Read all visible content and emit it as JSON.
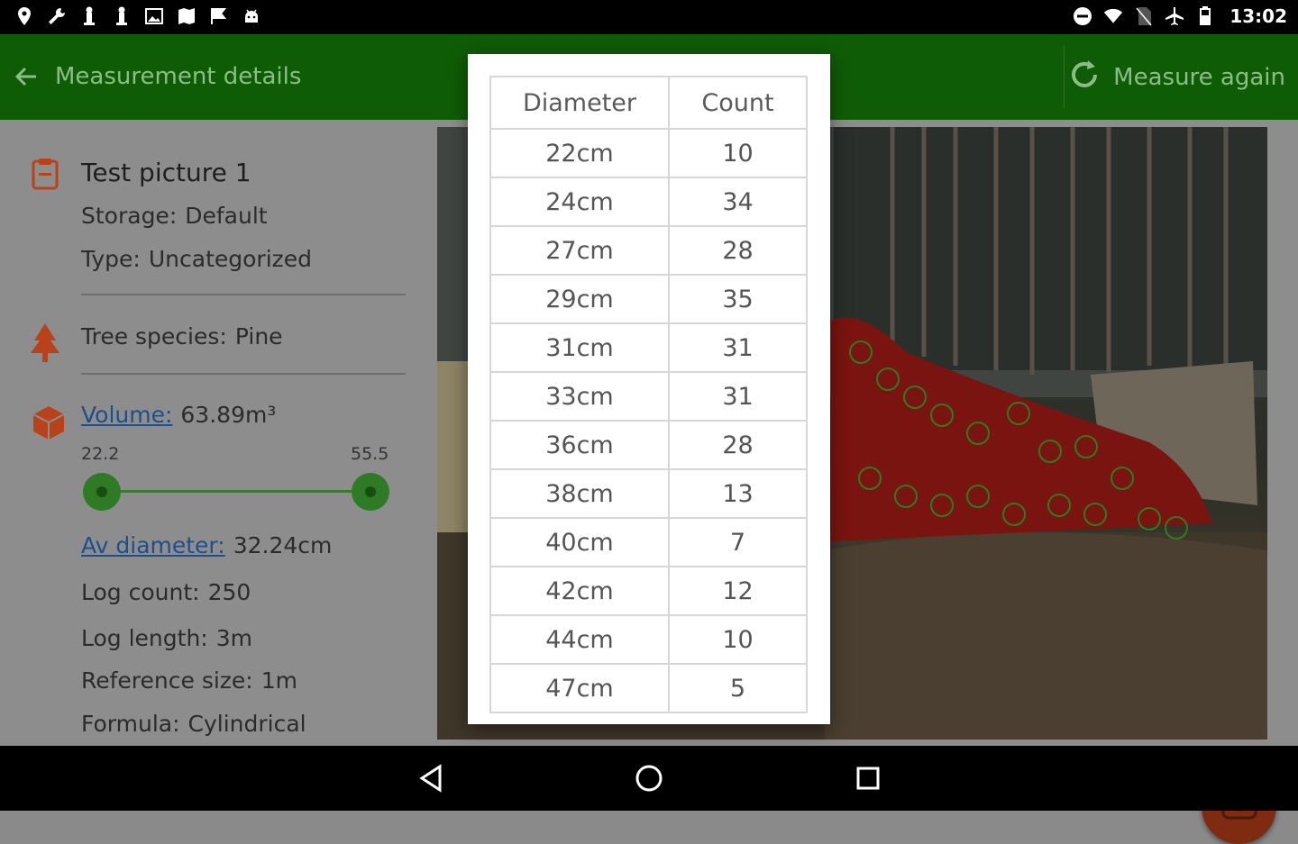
{
  "status_bar": {
    "time": "13:02",
    "left_icons": [
      "location-pin-icon",
      "wrench-icon",
      "chess-piece-icon",
      "chess-piece-icon",
      "image-icon",
      "map-icon",
      "flag-icon",
      "android-icon"
    ],
    "right_icons": [
      "do-not-disturb-icon",
      "wifi-icon",
      "no-sim-icon",
      "airplane-icon",
      "battery-icon"
    ]
  },
  "app_bar": {
    "title": "Measurement details",
    "action_label": "Measure again",
    "color": "#0f5c06"
  },
  "details": {
    "picture_title": "Test picture 1",
    "storage_label": "Storage:",
    "storage_value": "Default",
    "type_label": "Type:",
    "type_value": "Uncategorized",
    "species_label": "Tree species:",
    "species_value": "Pine",
    "volume_label": "Volume:",
    "volume_value": "63.89m³",
    "range_min": "22.2",
    "range_max": "55.5",
    "diameter_label": "Av diameter:",
    "diameter_value": "32.24cm",
    "log_count_label": "Log count:",
    "log_count_value": "250",
    "log_length_label": "Log length:",
    "log_length_value": "3m",
    "reference_label": "Reference size:",
    "reference_value": "1m",
    "formula_label": "Formula:",
    "formula_value": "Cylindrical"
  },
  "diameter_table": {
    "headers": [
      "Diameter",
      "Count"
    ],
    "rows": [
      [
        "22cm",
        "10"
      ],
      [
        "24cm",
        "34"
      ],
      [
        "27cm",
        "28"
      ],
      [
        "29cm",
        "35"
      ],
      [
        "31cm",
        "31"
      ],
      [
        "33cm",
        "31"
      ],
      [
        "36cm",
        "28"
      ],
      [
        "38cm",
        "13"
      ],
      [
        "40cm",
        "7"
      ],
      [
        "42cm",
        "12"
      ],
      [
        "44cm",
        "10"
      ],
      [
        "47cm",
        "5"
      ]
    ]
  },
  "icon_colors": {
    "accent_orange": "#b8421a"
  }
}
